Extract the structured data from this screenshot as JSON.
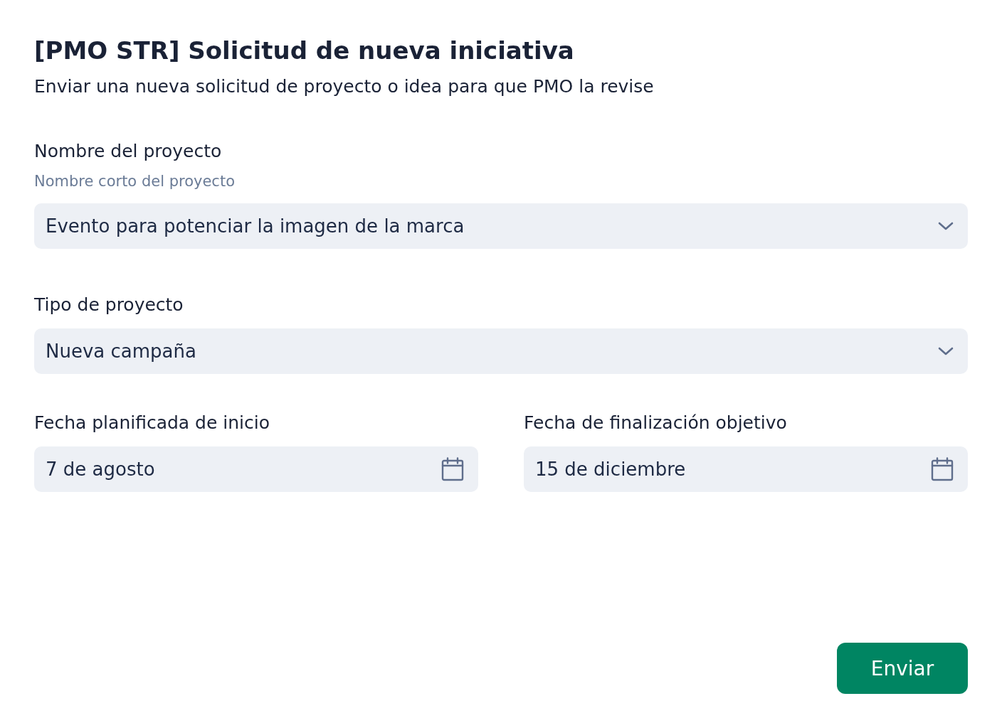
{
  "title": "[PMO STR] Solicitud de nueva iniciativa",
  "description": "Enviar una nueva solicitud de proyecto o idea para que PMO la revise",
  "fields": [
    {
      "kind": "select",
      "label": "Nombre del proyecto",
      "hint": "Nombre corto del proyecto",
      "value": "Evento para potenciar la imagen de la marca"
    },
    {
      "kind": "select",
      "label": "Tipo de proyecto",
      "value": "Nueva campaña"
    },
    {
      "kind": "date",
      "label": "Fecha planificada de inicio",
      "value": "7 de agosto"
    },
    {
      "kind": "date",
      "label": "Fecha de finalización objetivo",
      "value": "15 de diciembre"
    }
  ],
  "submit_button": "Enviar"
}
